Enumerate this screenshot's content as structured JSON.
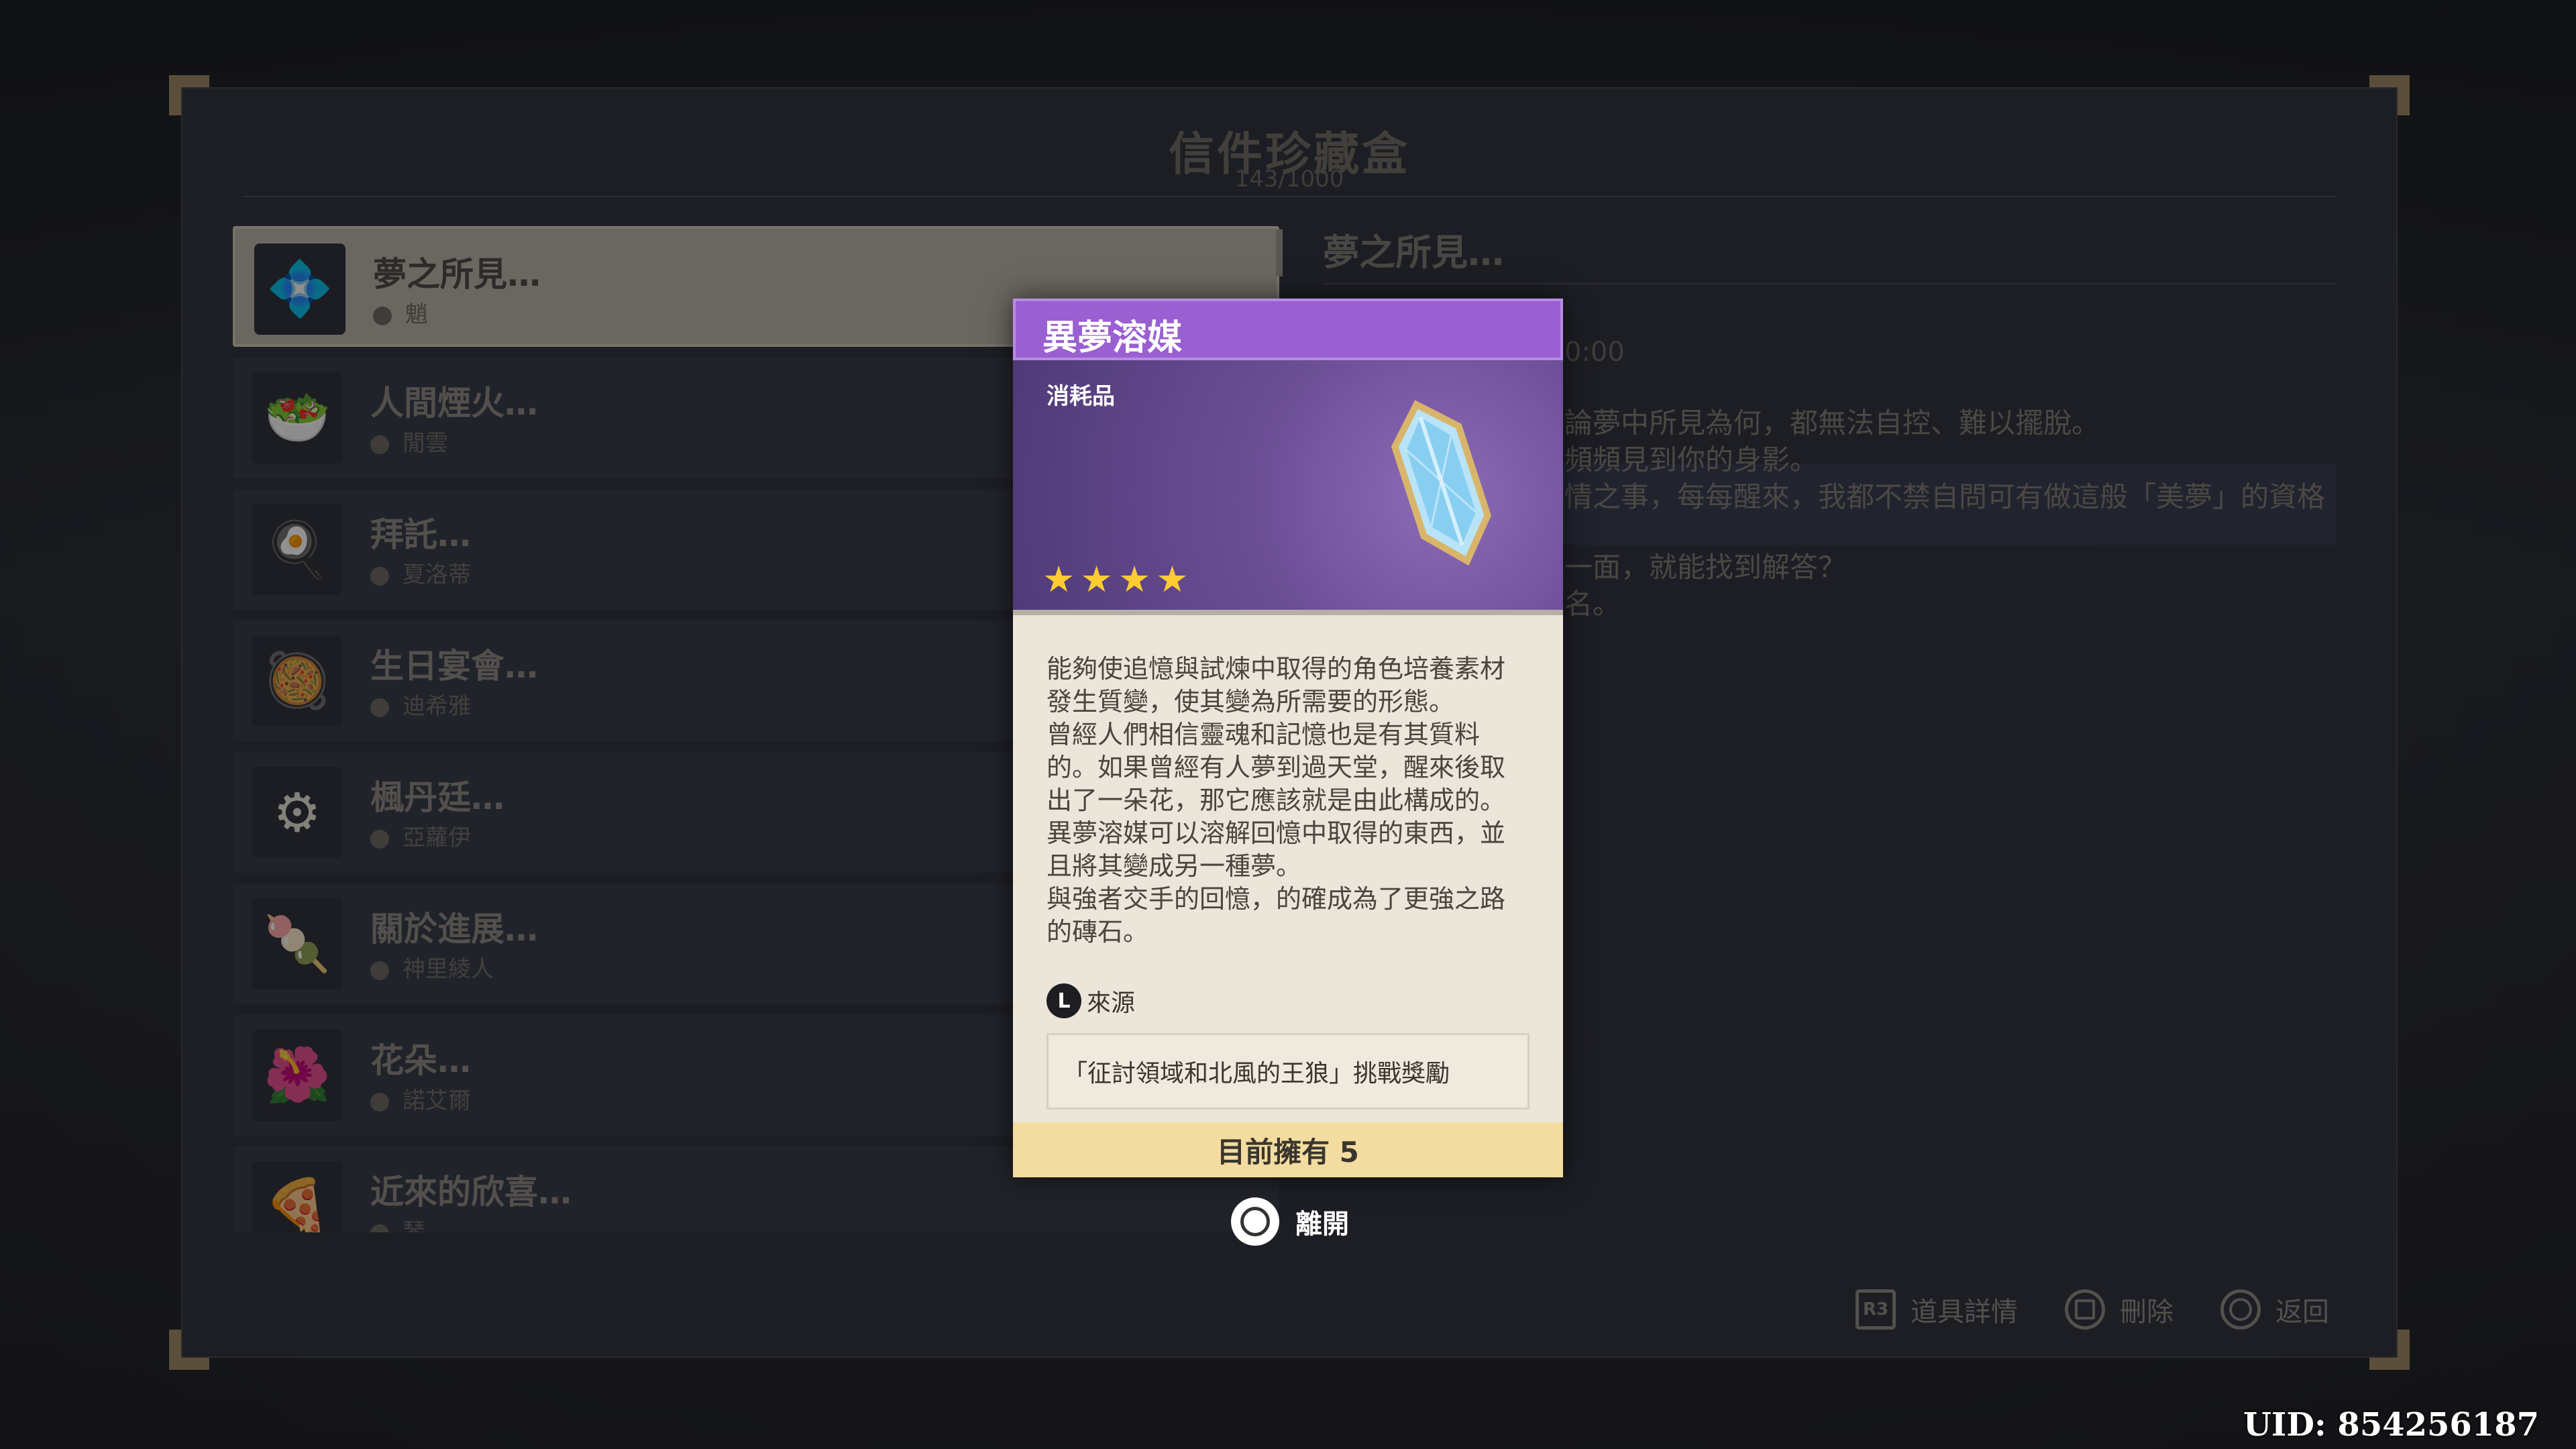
{
  "panel": {
    "title": "信件珍藏盒",
    "count": "143/1000"
  },
  "letters": [
    {
      "title": "夢之所見…",
      "sender": "魈",
      "icon": "crystal-icon",
      "selected": true
    },
    {
      "title": "人間煙火…",
      "sender": "閒雲",
      "icon": "dish-icon"
    },
    {
      "title": "拜託…",
      "sender": "夏洛蒂",
      "icon": "dish-icon"
    },
    {
      "title": "生日宴會…",
      "sender": "迪希雅",
      "icon": "dish-icon"
    },
    {
      "title": "楓丹廷…",
      "sender": "亞蘿伊",
      "icon": "gear-icon"
    },
    {
      "title": "關於進展…",
      "sender": "神里綾人",
      "icon": "dish-icon"
    },
    {
      "title": "花朵…",
      "sender": "諾艾爾",
      "icon": "flower-icon"
    },
    {
      "title": "近來的欣喜…",
      "sender": "琴",
      "icon": "dish-icon"
    }
  ],
  "detail": {
    "title": "夢之所見…",
    "time": "0:00",
    "lines": [
      "論夢中所見為何，都無法自控、難以擺脫。",
      "頻頻見到你的身影。",
      "情之事，每每醒來，我都不禁自問可有做這般「美夢」的資格",
      "一面，就能找到解答？",
      "名。"
    ]
  },
  "item_card": {
    "name": "異夢溶媒",
    "type": "消耗品",
    "rarity": 4,
    "description": [
      "能夠使追憶與試煉中取得的角色培養素材發生質變，使其變為所需要的形態。",
      "曾經人們相信靈魂和記憶也是有其質料的。如果曾經有人夢到過天堂，醒來後取出了一朵花，那它應該就是由此構成的。異夢溶媒可以溶解回憶中取得的東西，並且將其變成另一種夢。",
      "與強者交手的回憶，的確成為了更強之路的磚石。"
    ],
    "source_button": "L",
    "source_label": "來源",
    "source": "「征討領域和北風的王狼」挑戰獎勵",
    "owned": "目前擁有 5",
    "header_color": "#9a5fd1",
    "star_color": "#ffcc33"
  },
  "leave": {
    "label": "離開"
  },
  "hints": [
    {
      "label": "道具詳情",
      "button": "R3"
    },
    {
      "label": "刪除",
      "button": "square"
    },
    {
      "label": "返回",
      "button": "circle"
    }
  ],
  "uid": "UID: 854256187"
}
